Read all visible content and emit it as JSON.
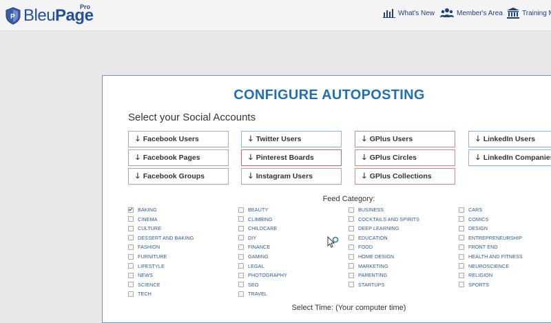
{
  "header": {
    "logo_text_regular": "Bleu",
    "logo_text_bold": "Page",
    "logo_badge": "Pro",
    "nav": [
      {
        "label": "What's New",
        "icon": "chart-icon"
      },
      {
        "label": "Member's Area",
        "icon": "group-icon"
      },
      {
        "label": "Training M",
        "icon": "bank-icon"
      }
    ]
  },
  "panel": {
    "title": "CONFIGURE AUTOPOSTING",
    "subtitle": "Select your Social Accounts",
    "accounts": [
      [
        "Facebook Users",
        "Facebook Pages",
        "Facebook Groups"
      ],
      [
        "Twitter Users",
        "Pinterest Boards",
        "Instagram Users"
      ],
      [
        "GPlus Users",
        "GPlus Circles",
        "GPlus Collections"
      ],
      [
        "LinkedIn Users",
        "LinkedIn Companies"
      ]
    ],
    "feed_category_label": "Feed Category:",
    "categories": {
      "col1": [
        "BAKING",
        "CINEMA",
        "CULTURE",
        "DESSERT AND BAKING",
        "FASHION",
        "FURNITURE",
        "LIFESTYLE",
        "NEWS",
        "SCIENCE",
        "TECH"
      ],
      "col2": [
        "BEAUTY",
        "CLIMBING",
        "CHILDCARE",
        "DIY",
        "FINANCE",
        "GAMING",
        "LEGAL",
        "PHOTOGRAPHY",
        "SEO",
        "TRAVEL"
      ],
      "col3": [
        "BUSINESS",
        "COCKTAILS AND SPIRITS",
        "DEEP LEARNING",
        "EDUCATION",
        "FOOD",
        "HOME DESIGN",
        "MARKETING",
        "PARENTING",
        "STARTUPS"
      ],
      "col4": [
        "CARS",
        "COMICS",
        "DESIGN",
        "ENTREPRENEURSHIP",
        "FRONT END",
        "HEALTH AND FITNESS",
        "NEUROSCIENCE",
        "RELIGION",
        "SPORTS"
      ]
    },
    "checked": [
      "BAKING"
    ],
    "select_time_label": "Select Time: (Your computer time)"
  },
  "colors": {
    "brand": "#244f9e",
    "title": "#2070b4",
    "category_text": "#2a5a93"
  }
}
